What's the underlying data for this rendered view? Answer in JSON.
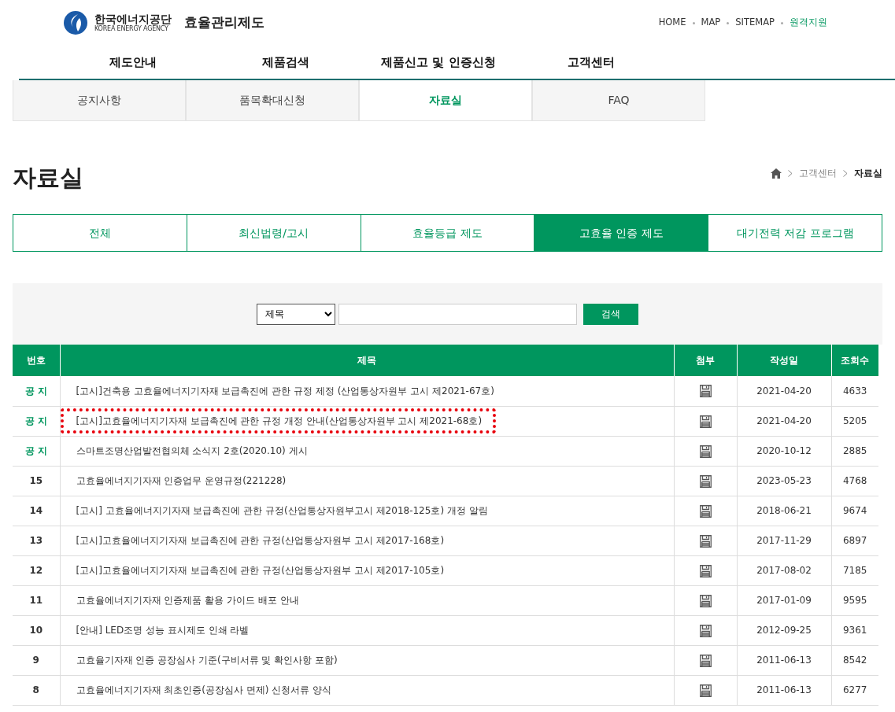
{
  "header": {
    "logo_name": "한국에너지공단",
    "logo_sub": "KOREA ENERGY AGENCY",
    "site_title": "효율관리제도",
    "util_links": [
      {
        "label": "HOME",
        "kind": "plain"
      },
      {
        "label": "MAP",
        "kind": "plain"
      },
      {
        "label": "SITEMAP",
        "kind": "plain"
      },
      {
        "label": "원격지원",
        "kind": "accent"
      }
    ],
    "main_nav": [
      "제도안내",
      "제품검색",
      "제품신고 및 인증신청",
      "고객센터"
    ]
  },
  "sub_tabs": [
    {
      "label": "공지사항",
      "selected": false
    },
    {
      "label": "품목확대신청",
      "selected": false
    },
    {
      "label": "자료실",
      "selected": true
    },
    {
      "label": "FAQ",
      "selected": false
    }
  ],
  "page_title": "자료실",
  "breadcrumb": [
    "고객센터",
    "자료실"
  ],
  "category_tabs": [
    {
      "label": "전체",
      "selected": false
    },
    {
      "label": "최신법령/고시",
      "selected": false
    },
    {
      "label": "효율등급 제도",
      "selected": false
    },
    {
      "label": "고효율 인증 제도",
      "selected": true
    },
    {
      "label": "대기전력 저감 프로그램",
      "selected": false
    }
  ],
  "search": {
    "select_value": "제목",
    "button": "검색"
  },
  "table": {
    "columns": [
      "번호",
      "제목",
      "첨부",
      "작성일",
      "조회수"
    ],
    "rows": [
      {
        "kind": "notice",
        "number": "공 지",
        "title": "[고시]건축용 고효율에너지기자재 보급촉진에 관한 규정 제정 (산업통상자원부 고시 제2021-67호)",
        "date": "2021-04-20",
        "views": "4633",
        "highlighted": false
      },
      {
        "kind": "notice",
        "number": "공 지",
        "title": "[고시]고효율에너지기자재 보급촉진에 관한 규정 개정 안내(산업통상자원부 고시 제2021-68호)",
        "date": "2021-04-20",
        "views": "5205",
        "highlighted": true
      },
      {
        "kind": "notice",
        "number": "공 지",
        "title": "스마트조명산업발전협의체 소식지 2호(2020.10) 게시",
        "date": "2020-10-12",
        "views": "2885",
        "highlighted": false
      },
      {
        "kind": "post",
        "number": "15",
        "title": "고효율에너지기자재 인증업무 운영규정(221228)",
        "date": "2023-05-23",
        "views": "4768",
        "highlighted": false
      },
      {
        "kind": "post",
        "number": "14",
        "title": "[고시] 고효율에너지기자재 보급촉진에 관한 규정(산업통상자원부고시 제2018-125호) 개정 알림",
        "date": "2018-06-21",
        "views": "9674",
        "highlighted": false
      },
      {
        "kind": "post",
        "number": "13",
        "title": "[고시]고효율에너지기자재 보급촉진에 관한 규정(산업통상자원부 고시 제2017-168호)",
        "date": "2017-11-29",
        "views": "6897",
        "highlighted": false
      },
      {
        "kind": "post",
        "number": "12",
        "title": "[고시]고효율에너지기자재 보급촉진에 관한 규정(산업통상자원부 고시 제2017-105호)",
        "date": "2017-08-02",
        "views": "7185",
        "highlighted": false
      },
      {
        "kind": "post",
        "number": "11",
        "title": "고효율에너지기자재 인증제품 활용 가이드 배포 안내",
        "date": "2017-01-09",
        "views": "9595",
        "highlighted": false
      },
      {
        "kind": "post",
        "number": "10",
        "title": "[안내] LED조명 성능 표시제도 인쇄 라벨",
        "date": "2012-09-25",
        "views": "9361",
        "highlighted": false
      },
      {
        "kind": "post",
        "number": "9",
        "title": "고효율기자재 인증 공장심사 기준(구비서류 및 확인사항 포함)",
        "date": "2011-06-13",
        "views": "8542",
        "highlighted": false
      },
      {
        "kind": "post",
        "number": "8",
        "title": "고효율에너지기자재 최초인증(공장심사 면제) 신청서류 양식",
        "date": "2011-06-13",
        "views": "6277",
        "highlighted": false
      }
    ]
  }
}
